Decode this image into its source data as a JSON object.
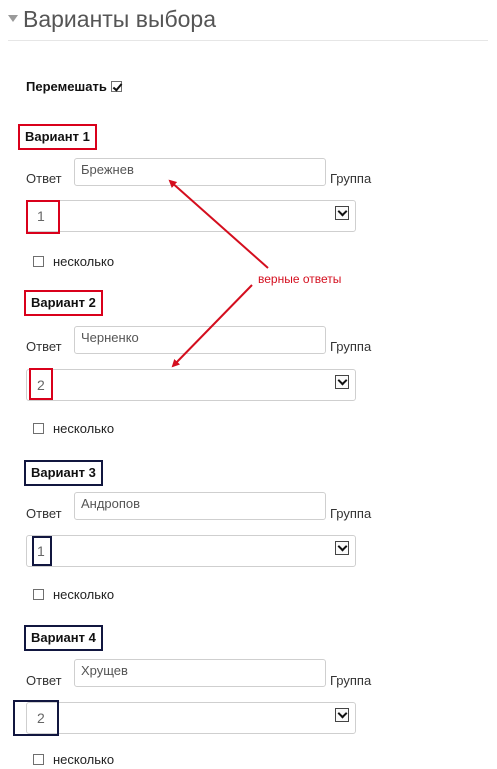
{
  "section": {
    "title": "Варианты выбора"
  },
  "shuffle": {
    "label": "Перемешать",
    "checked": true
  },
  "answer_label": "Ответ",
  "group_label": "Группа",
  "several_label": "несколько",
  "annotation": {
    "text": "верные ответы",
    "color": "#d40e1e"
  },
  "colors": {
    "highlight_red": "#d9001b",
    "highlight_navy": "#11163f"
  },
  "variants": [
    {
      "title": "Вариант 1",
      "answer": "Брежнев",
      "group": "1"
    },
    {
      "title": "Вариант 2",
      "answer": "Черненко",
      "group": "2"
    },
    {
      "title": "Вариант 3",
      "answer": "Андропов",
      "group": "1"
    },
    {
      "title": "Вариант 4",
      "answer": "Хрущев",
      "group": "2"
    }
  ]
}
